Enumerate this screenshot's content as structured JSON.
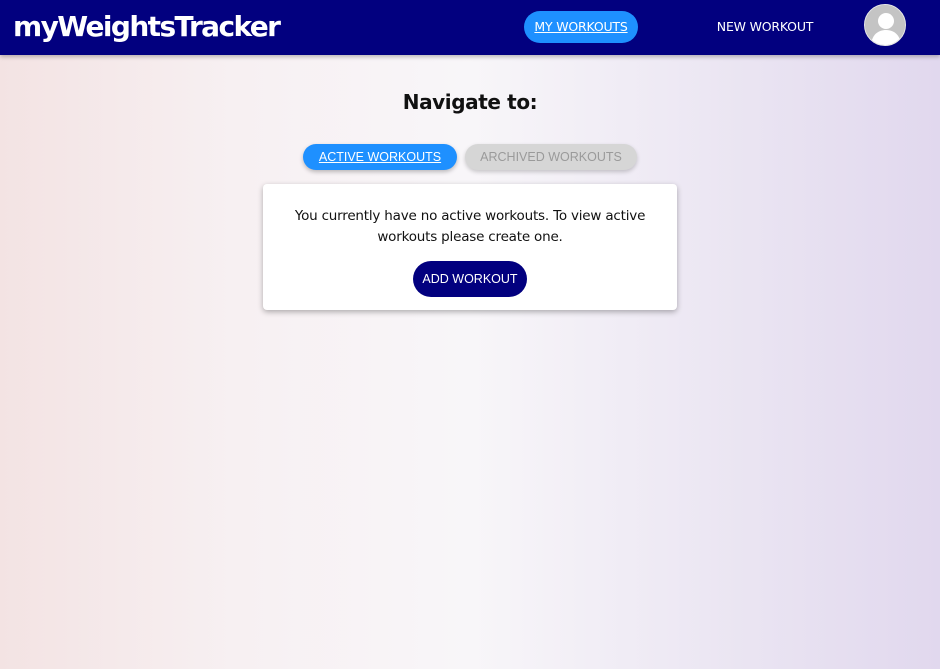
{
  "navbar": {
    "brand": "myWeightsTracker",
    "links": [
      {
        "label": "MY WORKOUTS",
        "active": true
      },
      {
        "label": "NEW WORKOUT",
        "active": false
      }
    ],
    "avatar_icon": "user-avatar-icon"
  },
  "main": {
    "heading": "Navigate to:",
    "tabs": [
      {
        "label": "ACTIVE WORKOUTS",
        "active": true
      },
      {
        "label": "ARCHIVED WORKOUTS",
        "active": false
      }
    ],
    "empty_state": {
      "message": "You currently have no active workouts. To view active workouts please create one.",
      "button_label": "ADD WORKOUT"
    }
  },
  "colors": {
    "navbar_bg": "#02007f",
    "accent": "#1e90ff",
    "tab_inactive_bg": "#d6d6d6",
    "button_bg": "#02007f"
  }
}
